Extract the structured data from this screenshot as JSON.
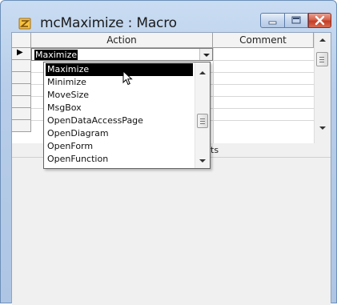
{
  "window": {
    "title": "mcMaximize : Macro",
    "app_icon": "macro-icon",
    "minimize_icon": "minimize-icon",
    "maximize_icon": "maximize-icon",
    "close_icon": "close-icon",
    "colors": {
      "close": "#c23e25",
      "selection": "#000000",
      "frame": "#b7cde9"
    }
  },
  "grid": {
    "columns": [
      "Action",
      "Comment"
    ],
    "current_row_indicator": "▶",
    "current_action": "Maximize"
  },
  "dropdown": {
    "items": [
      "Maximize",
      "Minimize",
      "MoveSize",
      "MsgBox",
      "OpenDataAccessPage",
      "OpenDiagram",
      "OpenForm",
      "OpenFunction"
    ],
    "selected": "Maximize",
    "arrow_icon": "chevron-down-icon"
  },
  "arguments_fragment": "ts"
}
